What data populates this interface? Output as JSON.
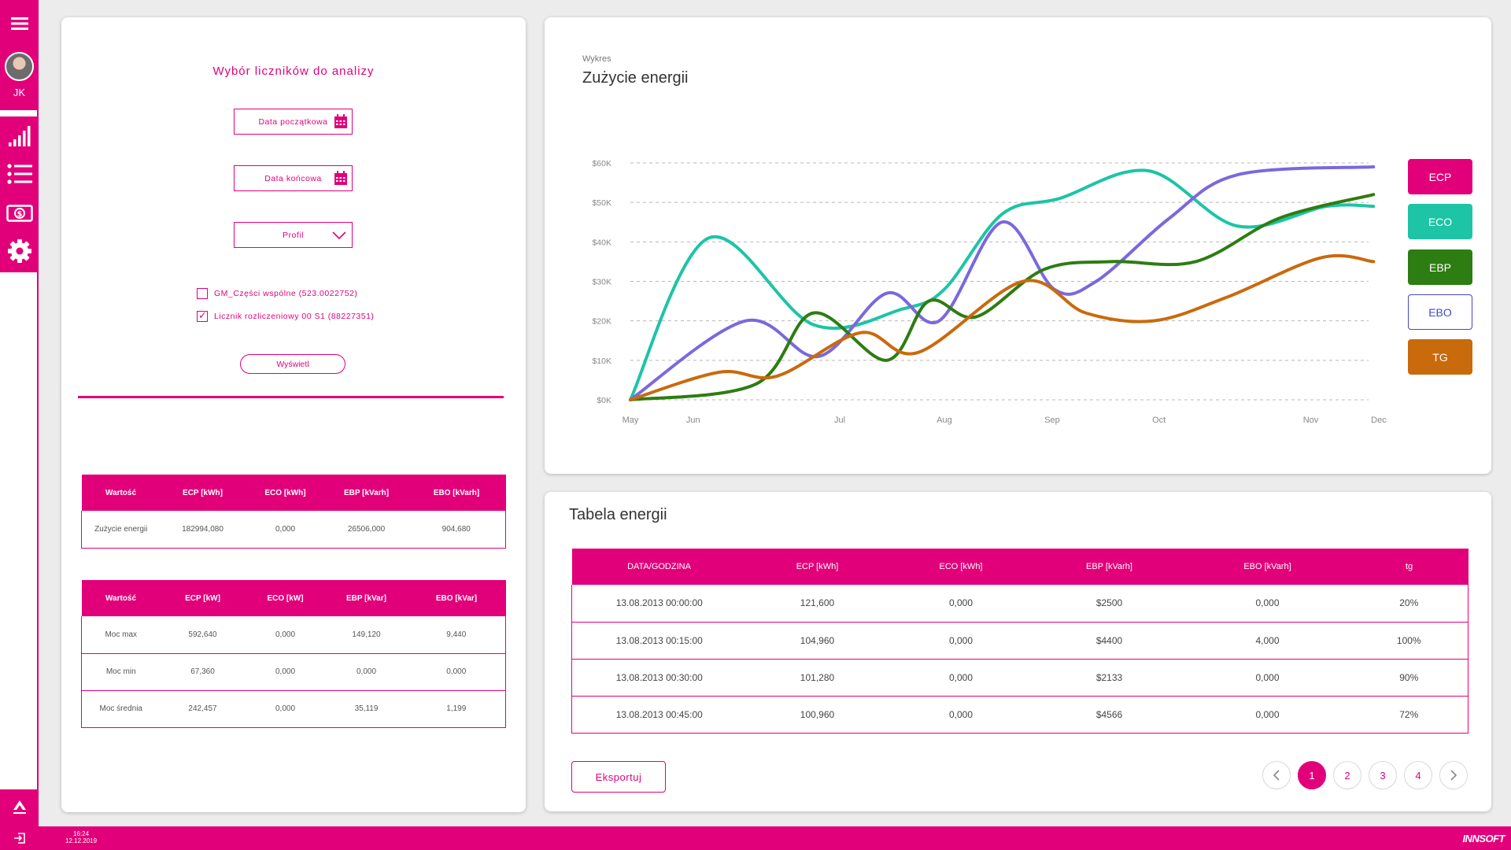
{
  "sidebar": {
    "user_initials": "JK",
    "items": [
      {
        "icon": "menu-icon"
      },
      {
        "icon": "bar-chart-icon"
      },
      {
        "icon": "list-icon"
      },
      {
        "icon": "money-icon"
      },
      {
        "icon": "gear-icon"
      }
    ],
    "bottom_logo": "tauron-logo"
  },
  "bottom_bar": {
    "time": "16:24",
    "date": "12.12.2019",
    "brand": "INNSOFT"
  },
  "left_panel": {
    "title": "Wybór liczników do analizy",
    "start_date_placeholder": "Data początkowa",
    "end_date_placeholder": "Data końcowa",
    "profile_select": "Profil",
    "meters": [
      {
        "label": "GM_Części wspólne (523.0022752)",
        "checked": false
      },
      {
        "label": "Licznik rozliczeniowy 00 S1 (88227351)",
        "checked": true
      }
    ],
    "show_button": "Wyświetl",
    "energy_table": {
      "headers": [
        "Wartość",
        "ECP [kWh]",
        "ECO [kWh]",
        "EBP [kVarh]",
        "EBO [kVarh]"
      ],
      "rows": [
        [
          "Zużycie energii",
          "182994,080",
          "0,000",
          "26506,000",
          "904,680"
        ]
      ]
    },
    "power_table": {
      "headers": [
        "Wartość",
        "ECP [kW]",
        "ECO [kW]",
        "EBP [kVar]",
        "EBO [kVar]"
      ],
      "rows": [
        [
          "Moc max",
          "592,640",
          "0,000",
          "149,120",
          "9,440"
        ],
        [
          "Moc min",
          "67,360",
          "0,000",
          "0,000",
          "0,000"
        ],
        [
          "Moc średnia",
          "242,457",
          "0,000",
          "35,119",
          "1,199"
        ]
      ]
    }
  },
  "chart_card": {
    "eyebrow": "Wykres",
    "title": "Zużycie energii",
    "legend": [
      {
        "label": "ECP",
        "color": "#e2007a",
        "outlined": false
      },
      {
        "label": "ECO",
        "color": "#1dc4a6",
        "outlined": false
      },
      {
        "label": "EBP",
        "color": "#2d7d12",
        "outlined": false
      },
      {
        "label": "EBO",
        "color": "#4646c8",
        "outlined": true
      },
      {
        "label": "TG",
        "color": "#c96a0c",
        "outlined": false
      }
    ]
  },
  "chart_data": {
    "type": "line",
    "x_ticks": [
      "May",
      "Jun",
      "Jul",
      "Aug",
      "Sep",
      "Oct",
      "Nov",
      "Dec"
    ],
    "x_tick_pos": [
      0,
      0.6,
      2.0,
      3.0,
      4.03,
      5.05,
      6.5,
      7.15
    ],
    "y_ticks": [
      "$0K",
      "$10K",
      "$20K",
      "$30K",
      "$40K",
      "$50K",
      "$60K"
    ],
    "ylim": [
      0,
      60
    ],
    "grid": true,
    "series": [
      {
        "color": "#1dc4a6",
        "points": [
          [
            0,
            0
          ],
          [
            0.75,
            41
          ],
          [
            1.75,
            19
          ],
          [
            2.6,
            23
          ],
          [
            3.0,
            28
          ],
          [
            3.55,
            47
          ],
          [
            4.1,
            51
          ],
          [
            4.95,
            58
          ],
          [
            5.8,
            44
          ],
          [
            6.65,
            49
          ],
          [
            7.1,
            49
          ]
        ]
      },
      {
        "color": "#7b68dd",
        "points": [
          [
            0,
            0
          ],
          [
            1.1,
            20
          ],
          [
            1.8,
            11
          ],
          [
            2.45,
            27
          ],
          [
            2.95,
            20
          ],
          [
            3.55,
            45
          ],
          [
            4.05,
            28
          ],
          [
            4.45,
            30
          ],
          [
            5.15,
            46
          ],
          [
            5.8,
            57
          ],
          [
            7.1,
            59
          ]
        ]
      },
      {
        "color": "#2d7d12",
        "points": [
          [
            0,
            0
          ],
          [
            1.2,
            4
          ],
          [
            1.75,
            22
          ],
          [
            2.45,
            10
          ],
          [
            2.85,
            25
          ],
          [
            3.3,
            21
          ],
          [
            3.95,
            33
          ],
          [
            4.6,
            35
          ],
          [
            5.4,
            35
          ],
          [
            6.2,
            46
          ],
          [
            7.1,
            52
          ]
        ]
      },
      {
        "color": "#c96a0c",
        "points": [
          [
            0,
            0
          ],
          [
            0.85,
            7
          ],
          [
            1.4,
            6
          ],
          [
            2.2,
            17
          ],
          [
            2.75,
            12
          ],
          [
            3.75,
            30
          ],
          [
            4.35,
            22
          ],
          [
            5.0,
            20
          ],
          [
            5.7,
            26
          ],
          [
            6.6,
            36
          ],
          [
            7.1,
            35
          ]
        ]
      }
    ]
  },
  "table_card": {
    "title": "Tabela energii",
    "headers": [
      "DATA/GODZINA",
      "ECP [kWh]",
      "ECO [kWh]",
      "EBP [kVarh]",
      "EBO [kVarh]",
      "tg"
    ],
    "rows": [
      [
        "13.08.2013 00:00:00",
        "121,600",
        "0,000",
        "$2500",
        "0,000",
        "20%"
      ],
      [
        "13.08.2013 00:15:00",
        "104,960",
        "0,000",
        "$4400",
        "4,000",
        "100%"
      ],
      [
        "13.08.2013 00:30:00",
        "101,280",
        "0,000",
        "$2133",
        "0,000",
        "90%"
      ],
      [
        "13.08.2013 00:45:00",
        "100,960",
        "0,000",
        "$4566",
        "0,000",
        "72%"
      ]
    ],
    "export_button": "Eksportuj",
    "pagination": {
      "pages": [
        "1",
        "2",
        "3",
        "4"
      ],
      "active": "1"
    }
  }
}
